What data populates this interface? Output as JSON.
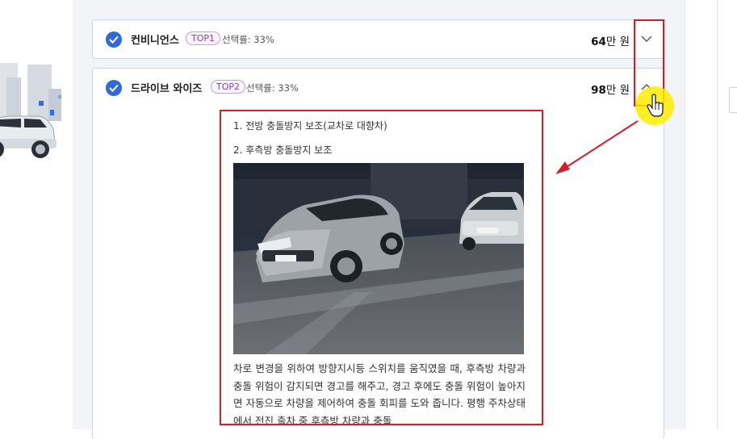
{
  "accordion": {
    "item1": {
      "title": "컨비니언스",
      "badge": "TOP1",
      "selection_rate": "선택률: 33%",
      "price_amount": "64",
      "price_unit": "만 원",
      "expanded": false,
      "checked": true
    },
    "item2": {
      "title": "드라이브 와이즈",
      "badge": "TOP2",
      "selection_rate": "선택률: 33%",
      "price_amount": "98",
      "price_unit": "만 원",
      "expanded": true,
      "checked": true,
      "details": {
        "line1": "1. 전방 충돌방지 보조(교차로 대향차)",
        "line2": "2. 후측방 충돌방지 보조",
        "description": "차로 변경을 위하여 방향지시등 스위치를 움직였을 때, 후측방 차량과 충돌 위험이 감지되면 경고를 해주고, 경고 후에도 충돌 위험이 높아지면 자동으로 차량을 제어하여 충돌 회피를 도와 줍니다. 평행 주차상태에서 전진 출차 중 후측방 차량과 충돌"
      }
    }
  },
  "colors": {
    "check_blue": "#2f6bd6",
    "badge_purple": "#8b3ec7",
    "annotation_red": "#d01e2b",
    "cursor_highlight": "#ffec00"
  },
  "icons": {
    "check": "check-circle-icon",
    "collapsed": "chevron-down-icon",
    "expanded": "chevron-up-icon",
    "pointer": "hand-pointer-icon"
  }
}
